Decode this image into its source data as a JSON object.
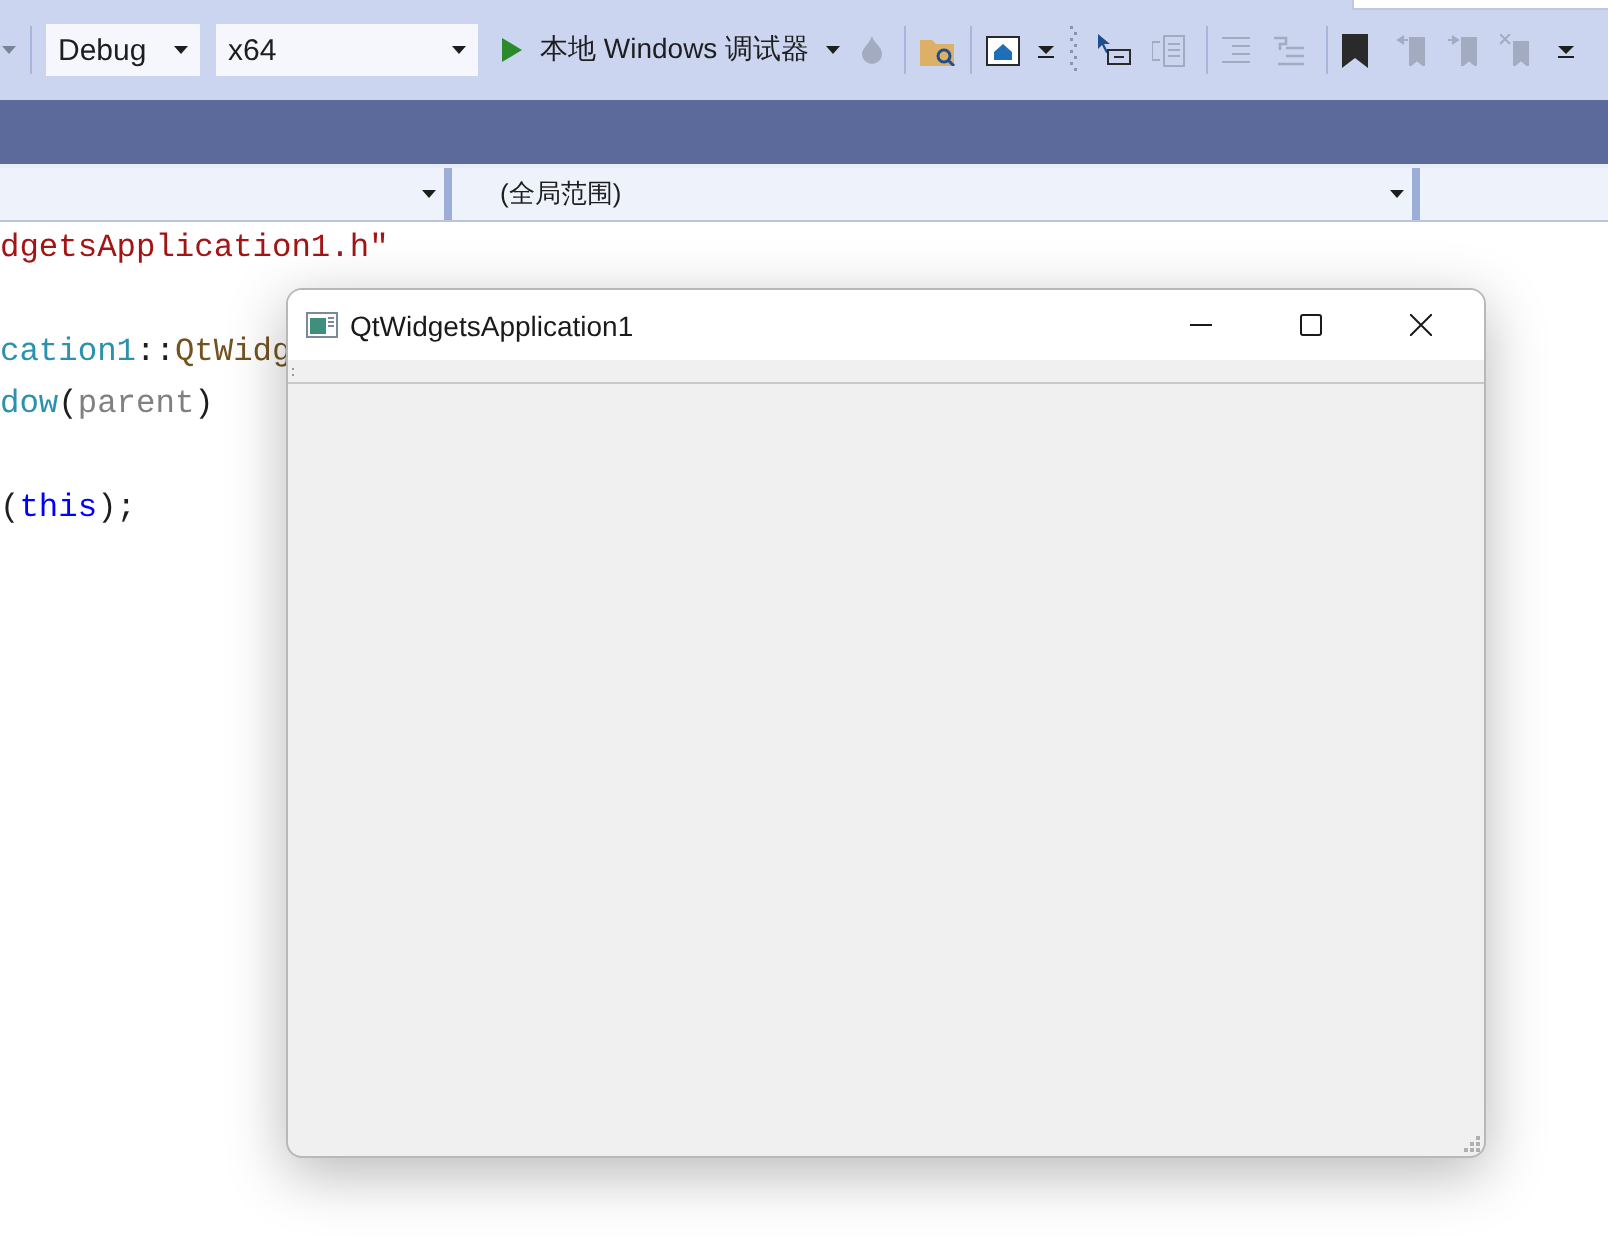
{
  "toolbar": {
    "configuration": "Debug",
    "platform": "x64",
    "run_label": "本地 Windows 调试器"
  },
  "navigation": {
    "scope": "(全局范围)"
  },
  "code_lines": [
    {
      "kind": "code",
      "segments": [
        {
          "kind": "string",
          "text": "dgetsApplication1.h\""
        }
      ]
    },
    {
      "kind": "blank"
    },
    {
      "kind": "code",
      "segments": [
        {
          "kind": "type",
          "text": "cation1"
        },
        {
          "kind": "plain",
          "text": "::"
        },
        {
          "kind": "function",
          "text": "QtWidg"
        }
      ]
    },
    {
      "kind": "code",
      "segments": [
        {
          "kind": "type",
          "text": "dow"
        },
        {
          "kind": "plain",
          "text": "("
        },
        {
          "kind": "parameter",
          "text": "parent"
        },
        {
          "kind": "plain",
          "text": ")"
        }
      ]
    },
    {
      "kind": "blank"
    },
    {
      "kind": "code",
      "segments": [
        {
          "kind": "plain",
          "text": "("
        },
        {
          "kind": "keyword",
          "text": "this"
        },
        {
          "kind": "plain",
          "text": ");"
        }
      ]
    }
  ],
  "window": {
    "title": "QtWidgetsApplication1"
  }
}
